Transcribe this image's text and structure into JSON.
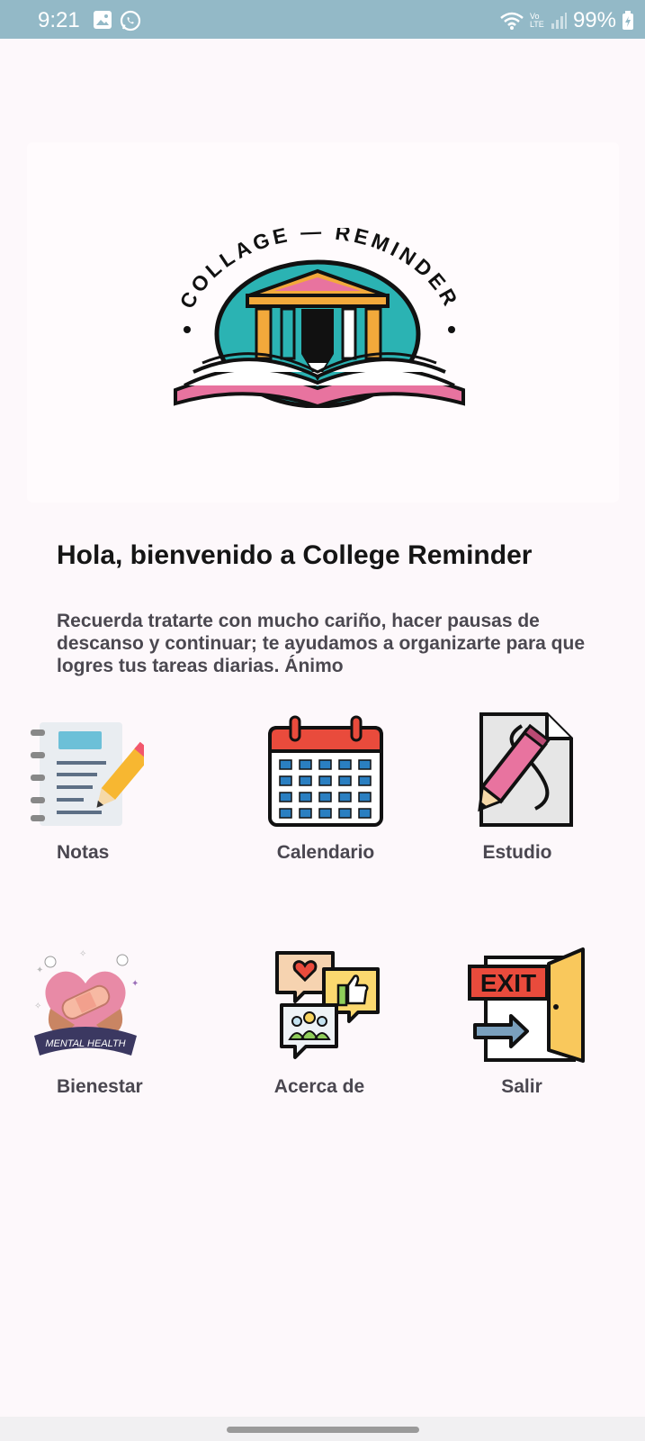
{
  "status_bar": {
    "time": "9:21",
    "battery": "99%",
    "network": "Vo LTE"
  },
  "logo": {
    "text_top": "COLLAGE — REMINDER"
  },
  "welcome": {
    "title": "Hola, bienvenido a College Reminder",
    "message": "Recuerda tratarte con mucho cariño, hacer pausas de descanso y continuar; te ayudamos a organizarte para que logres tus tareas diarias. Ánimo"
  },
  "menu": {
    "notes": "Notas",
    "calendar": "Calendario",
    "study": "Estudio",
    "wellness": "Bienestar",
    "about": "Acerca de",
    "exit": "Salir"
  },
  "icon_text": {
    "mental_health": "MENTAL HEALTH",
    "exit_sign": "EXIT"
  },
  "colors": {
    "status_bar": "#93b9c7",
    "background": "#fdf8fb",
    "teal": "#2bb3b3",
    "pink": "#e8739f",
    "calendar_red": "#e94b3c",
    "calendar_blue": "#2a7fc1"
  }
}
